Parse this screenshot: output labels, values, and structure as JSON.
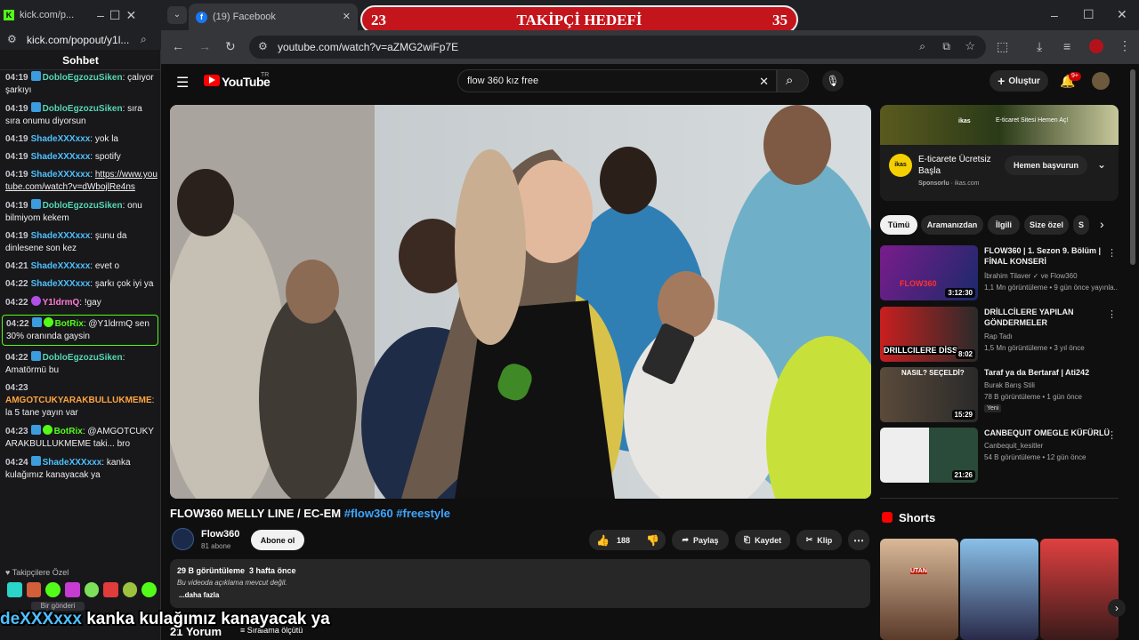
{
  "tabs": {
    "kick_tab": "kick.com/p...",
    "facebook_tab": "(19) Facebook"
  },
  "banner": {
    "left_num": "23",
    "title": "TAKİPÇİ HEDEFİ",
    "right_num": "35"
  },
  "address": {
    "url": "youtube.com/watch?v=aZMG2wiFp7E"
  },
  "chat": {
    "popout_url": "kick.com/popout/y1l...",
    "header": "Sohbet",
    "messages": [
      {
        "time": "04:19",
        "user": "DobloEgzozuSiken",
        "text": "çalıyor şarkıyı"
      },
      {
        "time": "04:19",
        "user": "DobloEgzozuSiken",
        "text": "sıra sıra onumu diyorsun"
      },
      {
        "time": "04:19",
        "user": "ShadeXXXxxx",
        "text": "yok la"
      },
      {
        "time": "04:19",
        "user": "ShadeXXXxxx",
        "text": "spotify"
      },
      {
        "time": "04:19",
        "user": "ShadeXXXxxx",
        "text": "https://www.youtube.com/watch?v=dWbojlRe4ns"
      },
      {
        "time": "04:19",
        "user": "DobloEgzozuSiken",
        "text": "onu bilmiyom kekem"
      },
      {
        "time": "04:19",
        "user": "ShadeXXXxxx",
        "text": "şunu da dinlesene son kez"
      },
      {
        "time": "04:21",
        "user": "ShadeXXXxxx",
        "text": "evet o"
      },
      {
        "time": "04:22",
        "user": "ShadeXXXxxx",
        "text": "şarkı çok iyi ya"
      },
      {
        "time": "04:22",
        "user": "Y1ldrmQ",
        "text": "!gay"
      },
      {
        "time": "04:22",
        "user": "BotRix",
        "text": "@Y1ldrmQ sen 30% oranında gaysin"
      },
      {
        "time": "04:22",
        "user": "DobloEgzozuSiken",
        "text": "Amatörmü bu"
      },
      {
        "time": "04:23",
        "user": "AMGOTCUKYARAKBULLUKMEME",
        "text": "la 5 tane yayın var"
      },
      {
        "time": "04:23",
        "user": "BotRix",
        "text": "@AMGOTCUKYARAKBULLUKMEME taki... bro"
      },
      {
        "time": "04:24",
        "user": "ShadeXXXxxx",
        "text": "kanka kulağımız kanayacak ya"
      }
    ],
    "followers_only": "Takipçilere Özel",
    "send_label": "Bir gönderi"
  },
  "youtube": {
    "logo": "YouTube",
    "logo_sup": "TR",
    "search_value": "flow 360 kız free",
    "create_label": "Oluştur",
    "notif_count": "9+",
    "video_title": "FLOW360 MELLY LINE / EC-EM",
    "video_tags": "#flow360 #freestyle",
    "channel": "Flow360",
    "subs": "81 abone",
    "subscribe": "Abone ol",
    "likes": "188",
    "share": "Paylaş",
    "save": "Kaydet",
    "clip": "Klip",
    "views": "29 B görüntüleme",
    "age": "3 hafta önce",
    "desc": "Bu videoda açıklama mevcut değil.",
    "more": "...daha fazla",
    "comments": "21 Yorum",
    "sort": "Sıralama ölçütü",
    "ad": {
      "title": "E-ticarete Ücretsiz Başla",
      "sponsored": "Sponsorlu",
      "domain": "ikas.com",
      "cta": "Hemen başvurun",
      "banner_text": "E-ticaret Sitesi Hemen Aç!",
      "brand": "ikas"
    },
    "chips": [
      "Tümü",
      "Aramanızdan",
      "İlgili",
      "Size özel",
      "S"
    ],
    "recs": [
      {
        "title": "FLOW360 | 1. Sezon 9. Bölüm | FİNAL KONSERİ",
        "channel": "İbrahim Tilaver ✓ ve Flow360",
        "meta": "1,1 Mn görüntüleme • 9 gün önce yayınla...",
        "duration": "3:12:30",
        "thumb_text": "FLOW360"
      },
      {
        "title": "DRİLLCİLERE YAPILAN GÖNDERMELER",
        "channel": "Rap Tadı",
        "meta": "1,5 Mn görüntüleme • 3 yıl önce",
        "duration": "8:02",
        "thumb_text": "DRILLCILERE DİSS"
      },
      {
        "title": "Taraf ya da Bertaraf | Ati242",
        "channel": "Burak Barış Stili",
        "meta": "78 B görüntüleme • 1 gün önce",
        "badge": "Yeni",
        "duration": "15:29",
        "thumb_text": "NASIL? SEÇELDİ?"
      },
      {
        "title": "CANBEQUIT OMEGLE KÜFÜRLÜ",
        "channel": "Canbequit_kesitler",
        "meta": "54 B görüntüleme • 12 gün önce",
        "duration": "21:26"
      }
    ],
    "shorts_label": "Shorts",
    "short_text": "UTAN"
  },
  "subtitle": {
    "user": "deXXXxxx",
    "text": "kanka kulağımız kanayacak ya"
  }
}
